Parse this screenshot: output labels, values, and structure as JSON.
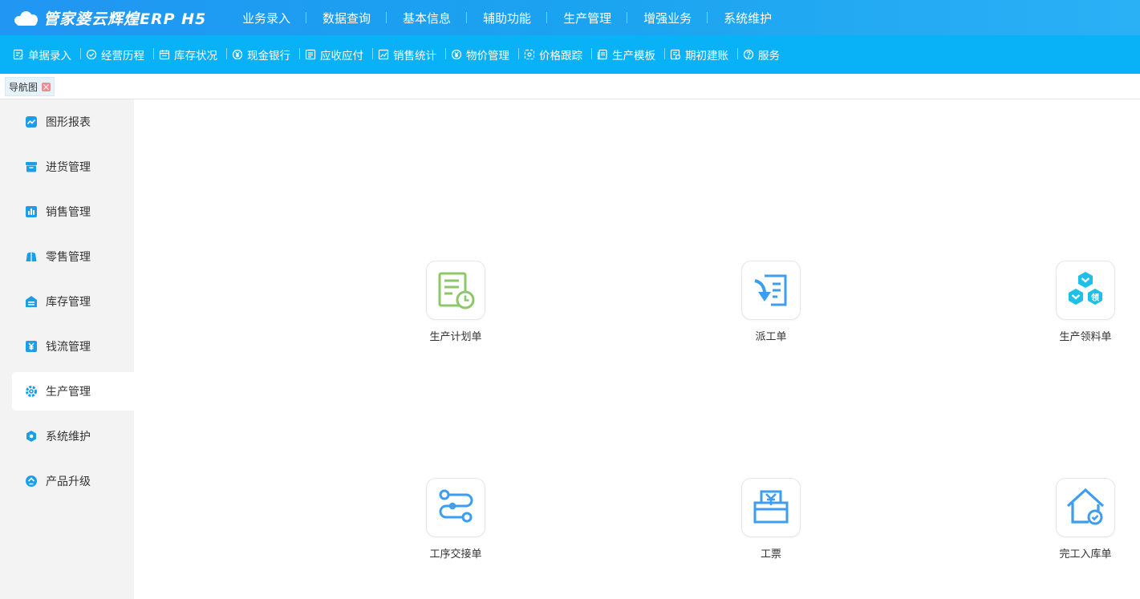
{
  "app": {
    "logo_text": "管家婆云辉煌ERP H5"
  },
  "topnav": [
    {
      "label": "业务录入"
    },
    {
      "label": "数据查询"
    },
    {
      "label": "基本信息"
    },
    {
      "label": "辅助功能"
    },
    {
      "label": "生产管理"
    },
    {
      "label": "增强业务"
    },
    {
      "label": "系统维护"
    }
  ],
  "subnav": [
    {
      "label": "单据录入",
      "icon": "edit-doc-icon"
    },
    {
      "label": "经营历程",
      "icon": "check-circle-icon"
    },
    {
      "label": "库存状况",
      "icon": "calendar-icon"
    },
    {
      "label": "现金银行",
      "icon": "yen-circle-icon"
    },
    {
      "label": "应收应付",
      "icon": "ledger-icon"
    },
    {
      "label": "销售统计",
      "icon": "chart-icon"
    },
    {
      "label": "物价管理",
      "icon": "yen-circle-icon"
    },
    {
      "label": "价格跟踪",
      "icon": "target-icon"
    },
    {
      "label": "生产模板",
      "icon": "template-icon"
    },
    {
      "label": "期初建账",
      "icon": "account-book-icon"
    },
    {
      "label": "服务",
      "icon": "help-circle-icon"
    }
  ],
  "tabs": [
    {
      "label": "导航图"
    }
  ],
  "sidebar": {
    "items": [
      {
        "label": "图形报表",
        "icon": "line-chart-icon"
      },
      {
        "label": "进货管理",
        "icon": "archive-box-icon"
      },
      {
        "label": "销售管理",
        "icon": "bar-chart-icon"
      },
      {
        "label": "零售管理",
        "icon": "shopping-bag-icon"
      },
      {
        "label": "库存管理",
        "icon": "warehouse-icon"
      },
      {
        "label": "钱流管理",
        "icon": "money-icon"
      },
      {
        "label": "生产管理",
        "icon": "gear-icon"
      },
      {
        "label": "系统维护",
        "icon": "hexagon-gear-icon"
      },
      {
        "label": "产品升级",
        "icon": "upgrade-icon"
      }
    ],
    "active_index": 6
  },
  "tiles": [
    {
      "label": "生产计划单",
      "icon": "production-plan-icon"
    },
    {
      "label": "派工单",
      "icon": "dispatch-icon"
    },
    {
      "label": "生产领料单",
      "icon": "material-requisition-icon"
    },
    {
      "label": "工序交接单",
      "icon": "process-handover-icon"
    },
    {
      "label": "工票",
      "icon": "work-ticket-icon"
    },
    {
      "label": "完工入库单",
      "icon": "completion-stock-icon"
    }
  ],
  "colors": {
    "topbar": "#2196f3",
    "subbar": "#09b2f7",
    "sidebar_icon": "#1a9ee8",
    "tile_green": "#8cc867",
    "tile_blue": "#3d9df0",
    "tile_cyan": "#1ec0e8"
  }
}
